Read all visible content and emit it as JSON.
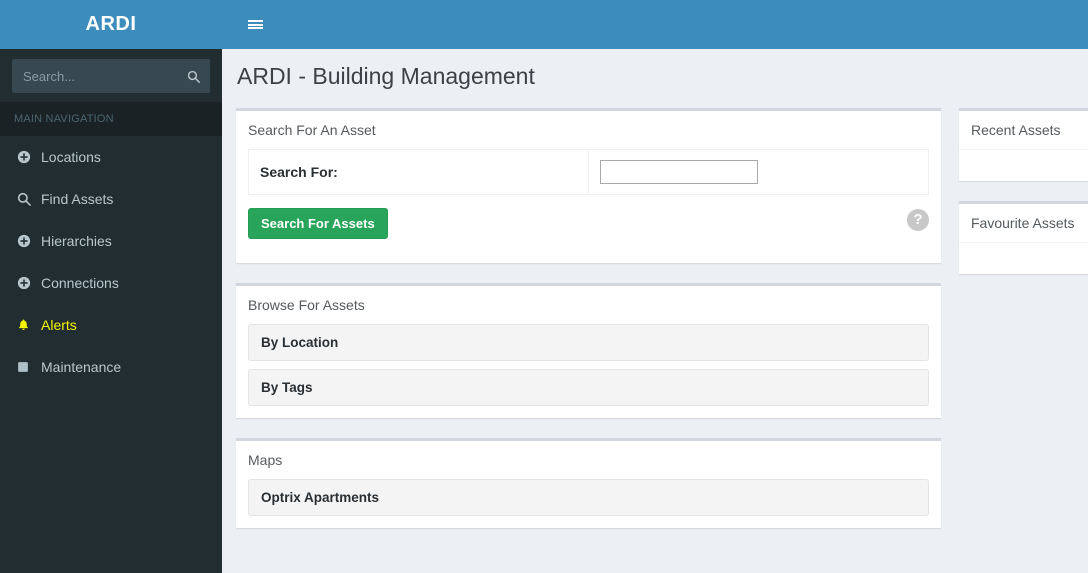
{
  "brand": {
    "name": "ARDI"
  },
  "navbar": {
    "toggle_icon": "hamburger-icon"
  },
  "sidebar": {
    "search": {
      "placeholder": "Search...",
      "value": "",
      "icon": "search-icon"
    },
    "section_header": "MAIN NAVIGATION",
    "items": [
      {
        "label": "Locations",
        "icon": "plus-circle-icon",
        "active": false
      },
      {
        "label": "Find Assets",
        "icon": "search-icon",
        "active": false
      },
      {
        "label": "Hierarchies",
        "icon": "plus-circle-icon",
        "active": false
      },
      {
        "label": "Connections",
        "icon": "plus-circle-icon",
        "active": false
      },
      {
        "label": "Alerts",
        "icon": "bell-icon",
        "active": true
      },
      {
        "label": "Maintenance",
        "icon": "square-icon",
        "active": false
      }
    ]
  },
  "page": {
    "title": "ARDI - Building Management"
  },
  "search_panel": {
    "header": "Search For An Asset",
    "field_label": "Search For:",
    "field_value": "",
    "button_label": "Search For Assets",
    "help_icon": "question-mark-icon",
    "help_glyph": "?"
  },
  "browse_panel": {
    "header": "Browse For Assets",
    "items": [
      {
        "label": "By Location"
      },
      {
        "label": "By Tags"
      }
    ]
  },
  "maps_panel": {
    "header": "Maps",
    "items": [
      {
        "label": "Optrix Apartments"
      }
    ]
  },
  "right_panels": [
    {
      "header": "Recent Assets",
      "items": []
    },
    {
      "header": "Favourite Assets",
      "items": []
    }
  ],
  "colors": {
    "brand_blue": "#3C8DBC",
    "sidebar_dark": "#222D32",
    "sidebar_header": "#1A2226",
    "content_bg": "#ECF0F5",
    "accent_green": "#28A55A",
    "alert_yellow": "#F4F400"
  }
}
